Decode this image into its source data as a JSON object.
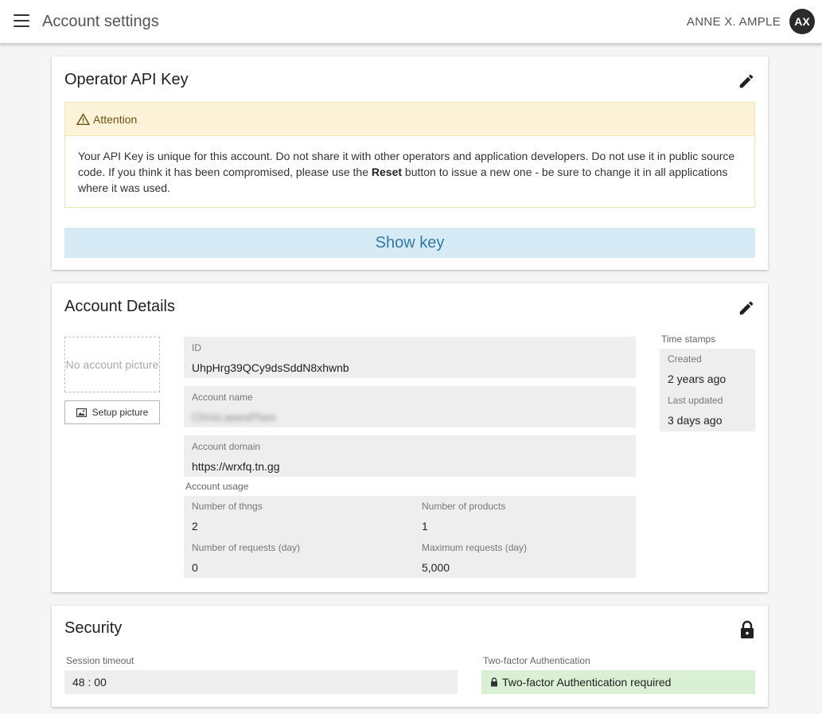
{
  "header": {
    "title": "Account settings",
    "user_name": "ANNE X. AMPLE",
    "avatar_initials": "AX"
  },
  "api_key_card": {
    "title": "Operator API Key",
    "attention_title": "Attention",
    "attention_text_1": "Your API Key is unique for this account. Do not share it with other operators and application developers. Do not use it in public source code. If you think it has been compromised, please use the ",
    "attention_bold": "Reset",
    "attention_text_2": " button to issue a new one - be sure to change it in all applications where it was used.",
    "show_key_label": "Show key"
  },
  "account_details": {
    "title": "Account Details",
    "no_picture_label": "No account picture",
    "setup_picture_label": "Setup picture",
    "id": {
      "label": "ID",
      "value": "UhpHrg39QCy9dsSddN8xhwnb"
    },
    "account_name": {
      "label": "Account name",
      "value": "ChrisLawesPhen"
    },
    "account_domain": {
      "label": "Account domain",
      "value": "https://wrxfq.tn.gg"
    },
    "usage": {
      "label": "Account usage",
      "thngs": {
        "label": "Number of thngs",
        "value": "2"
      },
      "products": {
        "label": "Number of products",
        "value": "1"
      },
      "requests": {
        "label": "Number of requests (day)",
        "value": "0"
      },
      "max_requests": {
        "label": "Maximum requests (day)",
        "value": "5,000"
      }
    },
    "timestamps": {
      "label": "Time stamps",
      "created": {
        "label": "Created",
        "value": "2 years ago"
      },
      "updated": {
        "label": "Last updated",
        "value": "3 days ago"
      }
    }
  },
  "security": {
    "title": "Security",
    "session_timeout": {
      "label": "Session timeout",
      "value": "48 : 00"
    },
    "two_factor": {
      "label": "Two-factor Authentication",
      "value": "Two-factor Authentication required"
    }
  },
  "colors": {
    "attention_bg": "#fcf3d8",
    "show_key_bg": "#d7ebf6",
    "show_key_text": "#3279a8",
    "tfa_bg": "#d9f0d5"
  }
}
